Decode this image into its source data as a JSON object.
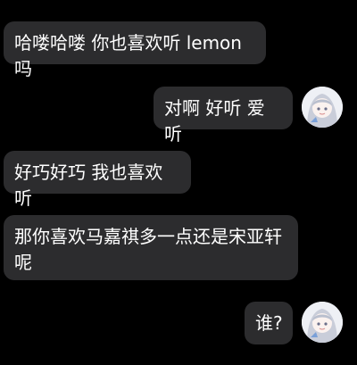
{
  "chat": {
    "messages": [
      {
        "side": "left",
        "text": "哈喽哈喽 你也喜欢听 lemon 吗"
      },
      {
        "side": "right",
        "text": "对啊 好听 爱听"
      },
      {
        "side": "left",
        "text": "好巧好巧 我也喜欢听"
      },
      {
        "side": "left",
        "text": "那你喜欢马嘉祺多一点还是宋亚轩呢"
      },
      {
        "side": "right",
        "text": "谁?"
      }
    ],
    "avatar_icon": "anime-girl-avatar-icon",
    "colors": {
      "background": "#000000",
      "bubble": "#2c2c2e",
      "text": "#ffffff"
    }
  }
}
